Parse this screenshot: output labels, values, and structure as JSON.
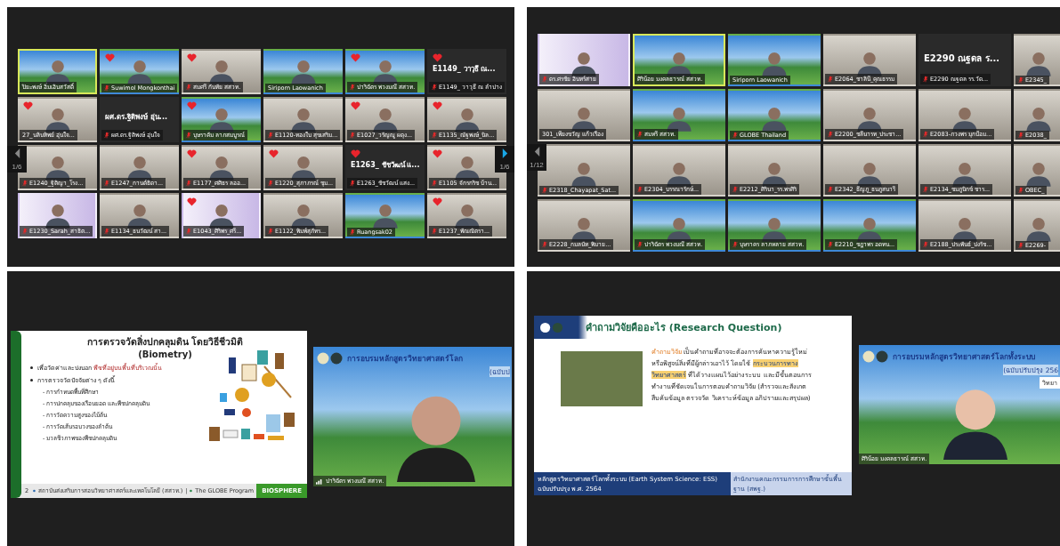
{
  "top_left": {
    "page_left": "1/6",
    "page_right": "1/6",
    "tiles": [
      {
        "kind": "landscape",
        "name": "ปิยะพงษ์ อิ่มเอิบสวัสดิ์",
        "heart": false,
        "muted": false,
        "selected": true
      },
      {
        "kind": "landscape",
        "name": "Suwimol Mongkonthai",
        "heart": true,
        "muted": true,
        "selected": false
      },
      {
        "kind": "room",
        "name": "สมศรี กันทัย สสวท.",
        "heart": true,
        "muted": true,
        "selected": false
      },
      {
        "kind": "landscape",
        "name": "Siriporn Laowanich",
        "heart": false,
        "muted": false,
        "selected": false
      },
      {
        "kind": "landscape",
        "name": "ปาริฉัตร พวงมณี สสวท.",
        "heart": true,
        "muted": true,
        "selected": false
      },
      {
        "kind": "name",
        "big_name": "E1149_ วาวุธี ณ...",
        "name": "E1149_ วาวุธี ณ ลำปาง",
        "heart": true,
        "muted": true,
        "selected": false
      },
      {
        "kind": "room",
        "name": "27_นลินทิพย์ อุ่นใจ...",
        "heart": true,
        "muted": false,
        "selected": false
      },
      {
        "kind": "name",
        "big_name": "ผศ.ดร.ฐิติพงษ์ อุ่น...",
        "name": "ผศ.ดร.ฐิติพงษ์ อุ่นใจ",
        "heart": false,
        "muted": true,
        "selected": false
      },
      {
        "kind": "landscape",
        "name": "บุษราคัม ลาภสมบูรณ์",
        "heart": true,
        "muted": true,
        "selected": false
      },
      {
        "kind": "room",
        "name": "E1120-ทองใบ สุขเสริม...",
        "heart": false,
        "muted": true,
        "selected": false
      },
      {
        "kind": "room",
        "name": "E1027_วรัญญู ผดุง...",
        "heart": true,
        "muted": true,
        "selected": false
      },
      {
        "kind": "room",
        "name": "E1135_ณัฐพงษ์_นิล...",
        "heart": true,
        "muted": true,
        "selected": false
      },
      {
        "kind": "room",
        "name": "E1240_ฐิติญา_โรง...",
        "heart": false,
        "muted": true,
        "selected": false
      },
      {
        "kind": "room",
        "name": "E1247_กานต์ธิดา...",
        "heart": false,
        "muted": true,
        "selected": false
      },
      {
        "kind": "room",
        "name": "E1177_ศศิธร ลออ...",
        "heart": true,
        "muted": true,
        "selected": false
      },
      {
        "kind": "room",
        "name": "E1220_สุภาภรณ์ ชุม...",
        "heart": true,
        "muted": true,
        "selected": false
      },
      {
        "kind": "name",
        "big_name": "E1263_ ชัชวัฒน์ แ...",
        "name": "E1263_ชัชวัฒน์ แสง...",
        "heart": true,
        "muted": true,
        "selected": false
      },
      {
        "kind": "room",
        "name": "E1105 จักรกริช บ้าน...",
        "heart": true,
        "muted": true,
        "selected": false
      },
      {
        "kind": "poster",
        "name": "E1230_Sarah_สาธิต...",
        "heart": false,
        "muted": true,
        "selected": false
      },
      {
        "kind": "room",
        "name": "E1134_ธนวัฒน์ สา...",
        "heart": false,
        "muted": true,
        "selected": false
      },
      {
        "kind": "poster",
        "name": "E1043_ศิริพร_ศรี...",
        "heart": true,
        "muted": true,
        "selected": false
      },
      {
        "kind": "room",
        "name": "E1122_พิมพ์สุภัทร...",
        "heart": false,
        "muted": true,
        "selected": false
      },
      {
        "kind": "landscape",
        "name": "Ruangsak02",
        "heart": false,
        "muted": true,
        "selected": false
      },
      {
        "kind": "room",
        "name": "E1237_พัณณิตรา...",
        "heart": true,
        "muted": true,
        "selected": false
      }
    ]
  },
  "top_right": {
    "page": "1/12",
    "tiles": [
      {
        "kind": "poster",
        "name": "ดร.ศรชัย อินทร์สาย",
        "heart": false,
        "muted": true,
        "selected": false
      },
      {
        "kind": "landscape",
        "name": "ศิริน้อย มงคลธารณ์ สสวท.",
        "heart": false,
        "muted": false,
        "selected": true
      },
      {
        "kind": "landscape",
        "name": "Siriporn Laowanich",
        "heart": false,
        "muted": false,
        "selected": false
      },
      {
        "kind": "room",
        "name": "E2064_ชาลินี_คุณธรรม",
        "heart": false,
        "muted": true,
        "selected": false
      },
      {
        "kind": "name",
        "big_name": "E2290 ณฐดล ร...",
        "name": "E2290 ณฐดล รร.วัด...",
        "heart": false,
        "muted": true,
        "selected": false
      },
      {
        "kind": "room",
        "name": "E2345_",
        "heart": false,
        "muted": true,
        "selected": false
      },
      {
        "kind": "room",
        "name": "301_เพียงขวัญ แก้วเรือง",
        "heart": false,
        "muted": false,
        "selected": false
      },
      {
        "kind": "landscape",
        "name": "สมหรี สสวท.",
        "heart": false,
        "muted": true,
        "selected": false
      },
      {
        "kind": "landscape",
        "name": "GLOBE Thailand",
        "heart": false,
        "muted": true,
        "selected": false
      },
      {
        "kind": "room",
        "name": "E2200_ชลีนารท_ประชา...",
        "heart": false,
        "muted": true,
        "selected": false
      },
      {
        "kind": "room",
        "name": "E2083-ภวงพร มุกป้อม...",
        "heart": false,
        "muted": true,
        "selected": false
      },
      {
        "kind": "room",
        "name": "E2038_",
        "heart": false,
        "muted": true,
        "selected": false
      },
      {
        "kind": "room",
        "name": "E2318_Chayapat_Sat...",
        "heart": false,
        "muted": true,
        "selected": false
      },
      {
        "kind": "room",
        "name": "E2304_บรรณารักษ์...",
        "heart": false,
        "muted": true,
        "selected": false
      },
      {
        "kind": "room",
        "name": "E2212_ศิรินา_รร.พรศิริ",
        "heart": false,
        "muted": true,
        "selected": false
      },
      {
        "kind": "room",
        "name": "E2342_ธีญภู_ธนภูสนารี",
        "heart": false,
        "muted": true,
        "selected": false
      },
      {
        "kind": "room",
        "name": "E2134_ชมภูนิกข์ ชาร...",
        "heart": false,
        "muted": true,
        "selected": false
      },
      {
        "kind": "room",
        "name": "OBEC_",
        "heart": false,
        "muted": true,
        "selected": false
      },
      {
        "kind": "room",
        "name": "E2228_กมลนัท_พิมาย...",
        "heart": false,
        "muted": true,
        "selected": false
      },
      {
        "kind": "landscape",
        "name": "ปาริฉัตร พวงมณี สสวท.",
        "heart": false,
        "muted": true,
        "selected": false
      },
      {
        "kind": "landscape",
        "name": "บุษราคร ลาภหลาย สสวท.",
        "heart": false,
        "muted": true,
        "selected": false
      },
      {
        "kind": "landscape",
        "name": "E2210_ชฎาพร อดทน...",
        "heart": false,
        "muted": true,
        "selected": false
      },
      {
        "kind": "room",
        "name": "E2188_ประพันธ์_ปงรัช...",
        "heart": false,
        "muted": true,
        "selected": false
      },
      {
        "kind": "room",
        "name": "E2269-",
        "heart": false,
        "muted": true,
        "selected": false
      }
    ]
  },
  "bottom_left": {
    "slide": {
      "title": "การตรวจวัดสิ่งปกคลุมดิน โดยวิธีชีวมิติ",
      "subtitle": "(Biometry)",
      "items": [
        {
          "kind": "bullet",
          "text": "เพื่อวัดค่าและบ่งบอก ",
          "emphasis": "พืชที่อยู่บนพื้นที่บริเวณนั้น"
        },
        {
          "kind": "bullet",
          "text": "การตรวจวัดปัจจัยต่าง ๆ  ดังนี้"
        },
        {
          "kind": "sub",
          "text": "- การกำหนดพื้นที่ศึกษา"
        },
        {
          "kind": "sub",
          "text": "- การปกคลุมของเรือนยอด และพืชปกคลุมดิน"
        },
        {
          "kind": "sub",
          "text": "- การวัดความสูงของไม้ต้น"
        },
        {
          "kind": "sub",
          "text": "- การวัดเส้นรอบวงของลำต้น"
        },
        {
          "kind": "sub",
          "text": "- มวลชีวภาพของพืชปกคลุมดิน"
        }
      ],
      "page": "2",
      "footer": "สถาบันส่งเสริมการสอนวิทยาศาสตร์และเทคโนโลยี (สสวท.)",
      "separator": "|",
      "program": "The GLOBE Program",
      "tag": "BIOSPHERE"
    },
    "video": {
      "banner": "การอบรมหลักสูตรวิทยาศาสตร์โลก",
      "banner_sub": "(ฉบับป",
      "name": "ปาริฉัตร พวงมณี สสวท."
    }
  },
  "bottom_right": {
    "slide": {
      "title": "คำถามวิจัยคืออะไร (Research Question)",
      "paragraph": [
        {
          "kind": "term",
          "text": "คำถามวิจัย"
        },
        {
          "kind": "plain",
          "text": " เป็นคำถามที่อาจจะต้องการค้นหาความรู้ใหม่ หรือพิสูจน์สิ่งที่มีผู้กล่าวเอาไว้ โดยใช้ "
        },
        {
          "kind": "highlight",
          "text": "กระบวนการทางวิทยาศาสตร์"
        },
        {
          "kind": "plain",
          "text": "  ที่ได้วางแผนไว้อย่างระบบ และมีขั้นตอนการทำงานที่ชัดเจนในการตอบคำถามวิจัย (สำรวจและสังเกต สืบค้นข้อมูล ตรวจวัด วิเคราะห์ข้อมูล อภิปรายและสรุปผล)"
        }
      ],
      "footer_left": "หลักสูตรวิทยาศาสตร์โลกทั้งระบบ (Earth System Science: ESS) ฉบับปรับปรุง พ.ศ. 2564",
      "footer_right": "สำนักงานคณะกรรมการการศึกษาขั้นพื้นฐาน (สพฐ.)"
    },
    "video": {
      "banner": "การอบรมหลักสูตรวิทยาศาสตร์โลกทั้งระบบ",
      "banner_sub": "(ฉบับปรับปรุง 256",
      "badge": "วิทยา",
      "name": "ศิริน้อย มงคลธารณ์ สสวท."
    }
  }
}
